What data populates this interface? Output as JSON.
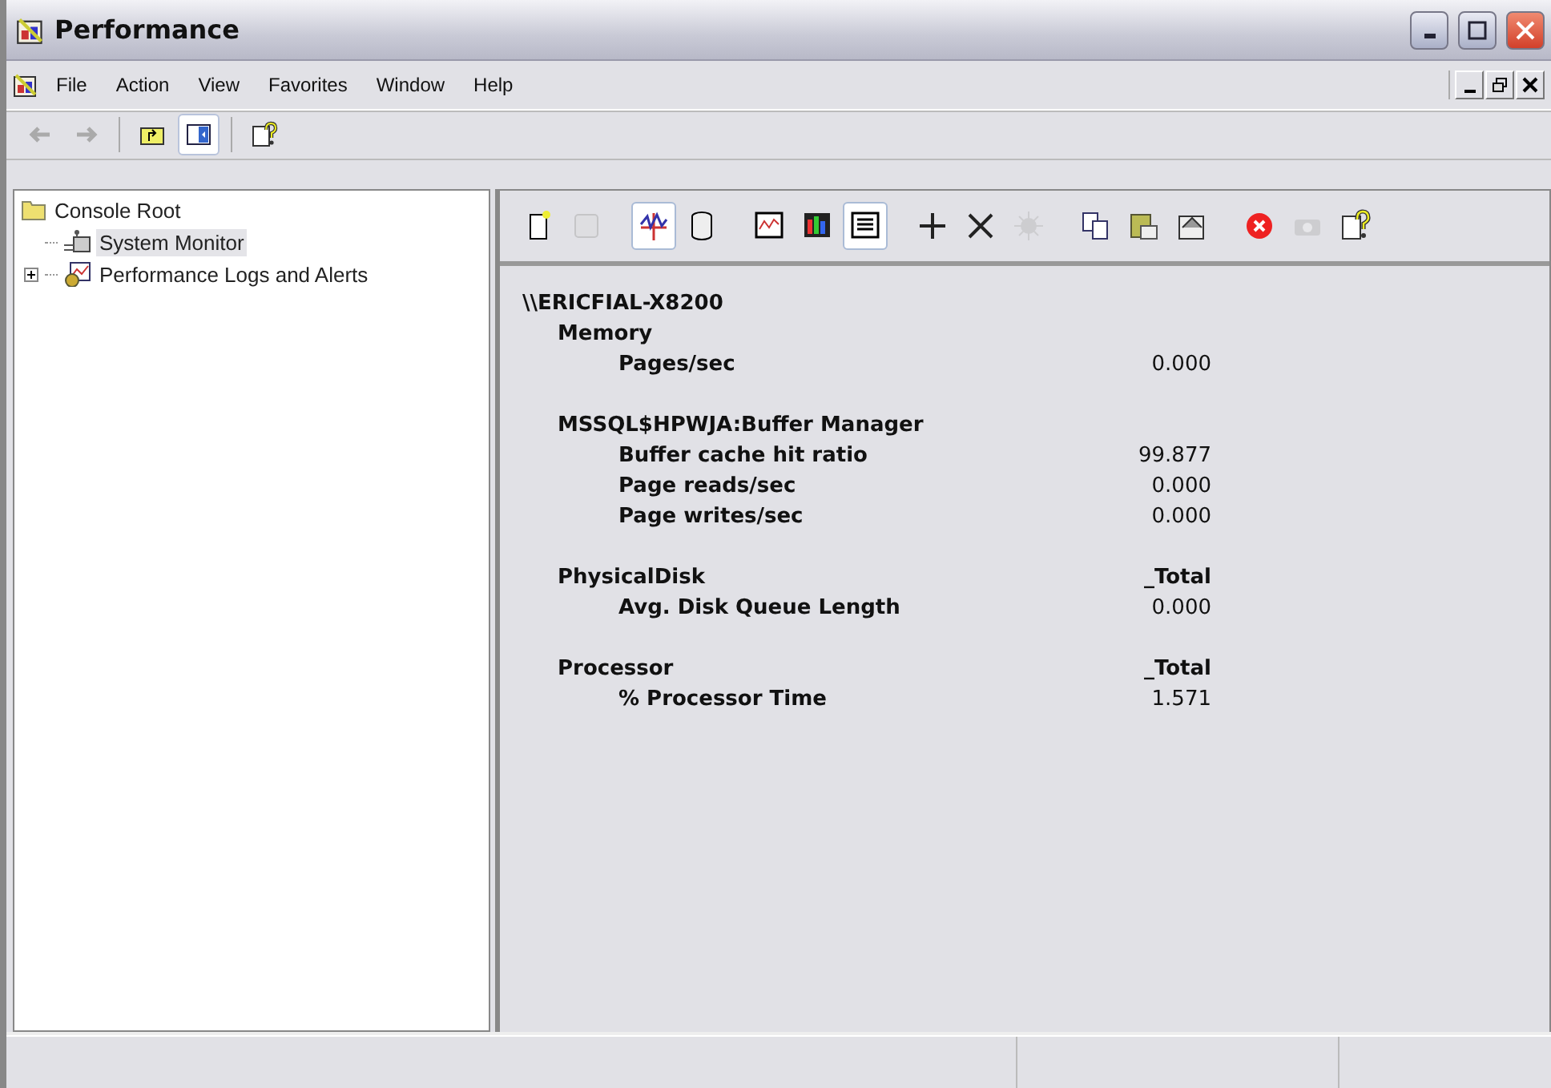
{
  "window": {
    "title": "Performance"
  },
  "menu": [
    "File",
    "Action",
    "View",
    "Favorites",
    "Window",
    "Help"
  ],
  "main_toolbar": [
    {
      "kind": "back",
      "disabled": true
    },
    {
      "kind": "forward",
      "disabled": true
    },
    {
      "kind": "sep"
    },
    {
      "kind": "up-folder",
      "selected": false
    },
    {
      "kind": "tree-toggle",
      "selected": true
    },
    {
      "kind": "sep"
    },
    {
      "kind": "help",
      "selected": false
    }
  ],
  "tree": [
    {
      "label": "Console Root",
      "selected": false,
      "children": [
        {
          "label": "System Monitor",
          "selected": true
        },
        {
          "label": "Performance Logs and Alerts",
          "selected": false,
          "expanded": false
        }
      ]
    }
  ],
  "monitor_toolbar": [
    {
      "kind": "new",
      "selected": false,
      "disabled": false
    },
    {
      "kind": "clear",
      "selected": false,
      "disabled": true
    },
    {
      "kind": "sep"
    },
    {
      "kind": "current",
      "selected": true,
      "disabled": false
    },
    {
      "kind": "log",
      "selected": false,
      "disabled": false
    },
    {
      "kind": "sep"
    },
    {
      "kind": "graph",
      "selected": false,
      "disabled": false
    },
    {
      "kind": "histogram",
      "selected": false,
      "disabled": false
    },
    {
      "kind": "report",
      "selected": true,
      "disabled": false
    },
    {
      "kind": "sep"
    },
    {
      "kind": "add",
      "selected": false,
      "disabled": false
    },
    {
      "kind": "delete",
      "selected": false,
      "disabled": false
    },
    {
      "kind": "highlight",
      "selected": false,
      "disabled": true
    },
    {
      "kind": "sep"
    },
    {
      "kind": "copy",
      "selected": false,
      "disabled": false
    },
    {
      "kind": "paste",
      "selected": false,
      "disabled": false
    },
    {
      "kind": "properties",
      "selected": false,
      "disabled": false
    },
    {
      "kind": "sep"
    },
    {
      "kind": "freeze",
      "selected": false,
      "disabled": false
    },
    {
      "kind": "update",
      "selected": false,
      "disabled": true
    },
    {
      "kind": "help",
      "selected": false,
      "disabled": false
    }
  ],
  "report": {
    "computer": "\\\\ERICFIAL-X8200",
    "objects": [
      {
        "name": "Memory",
        "counters": [
          {
            "name": "Pages/sec",
            "value": "0.000"
          }
        ]
      },
      {
        "name": "MSSQL$HPWJA:Buffer Manager",
        "counters": [
          {
            "name": "Buffer cache hit ratio",
            "value": "99.877"
          },
          {
            "name": "Page reads/sec",
            "value": "0.000"
          },
          {
            "name": "Page writes/sec",
            "value": "0.000"
          }
        ]
      },
      {
        "name": "PhysicalDisk",
        "instance": "_Total",
        "counters": [
          {
            "name": "Avg. Disk Queue Length",
            "value": "0.000"
          }
        ]
      },
      {
        "name": "Processor",
        "instance": "_Total",
        "counters": [
          {
            "name": "% Processor Time",
            "value": "1.571"
          }
        ]
      }
    ]
  }
}
